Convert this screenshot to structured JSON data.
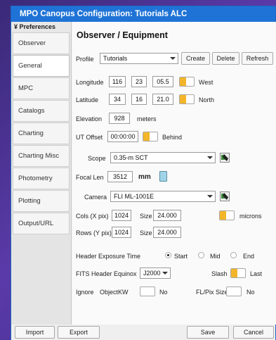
{
  "window": {
    "title": "MPO Canopus Configuration: Tutorials ALC"
  },
  "sidebar": {
    "header": "¥ Preferences",
    "items": [
      {
        "label": "Observer"
      },
      {
        "label": "General"
      },
      {
        "label": "MPC"
      },
      {
        "label": "Catalogs"
      },
      {
        "label": "Charting"
      },
      {
        "label": "Charting Misc"
      },
      {
        "label": "Photometry"
      },
      {
        "label": "Plotting"
      },
      {
        "label": "Output/URL"
      }
    ]
  },
  "panel": {
    "title": "Observer / Equipment",
    "profile": {
      "label": "Profile",
      "value": "Tutorials",
      "create": "Create",
      "delete": "Delete",
      "refresh": "Refresh"
    },
    "longitude": {
      "label": "Longitude",
      "deg": "116",
      "min": "23",
      "sec": "05.5",
      "dir": "West"
    },
    "latitude": {
      "label": "Latitude",
      "deg": "34",
      "min": "16",
      "sec": "21.0",
      "dir": "North"
    },
    "elevation": {
      "label": "Elevation",
      "value": "928",
      "unit": "meters"
    },
    "ut_offset": {
      "label": "UT Offset",
      "value": "00:00:00",
      "dir": "Behind"
    },
    "scope": {
      "label": "Scope",
      "value": "0.35-m SCT"
    },
    "focal_len": {
      "label": "Focal Len",
      "value": "3512",
      "unit": "mm"
    },
    "camera": {
      "label": "Camera",
      "value": "FLI ML-1001E"
    },
    "cols": {
      "label": "Cols (X pix)",
      "value": "1024",
      "size_label": "Size",
      "size": "24.000",
      "unit": "microns"
    },
    "rows": {
      "label": "Rows (Y pix)",
      "value": "1024",
      "size_label": "Size",
      "size": "24.000"
    },
    "header_exposure": {
      "label": "Header Exposure Time",
      "options": [
        "Start",
        "Mid",
        "End"
      ],
      "selected": "Start"
    },
    "fits_equinox": {
      "label": "FITS Header Equinox",
      "value": "J2000",
      "slash_label": "Slash",
      "last_label": "Last"
    },
    "ignore": {
      "label": "Ignore",
      "objectkw_label": "ObjectKW",
      "objectkw_value": "No",
      "flpix_label": "FL/Pix Size",
      "flpix_value": "No"
    }
  },
  "footer": {
    "import": "Import",
    "export": "Export",
    "save": "Save",
    "cancel": "Cancel"
  },
  "colors": {
    "titlebar": "#1f73d6",
    "toggle_accent": "#f3b62a",
    "background": "#4b34a0"
  }
}
